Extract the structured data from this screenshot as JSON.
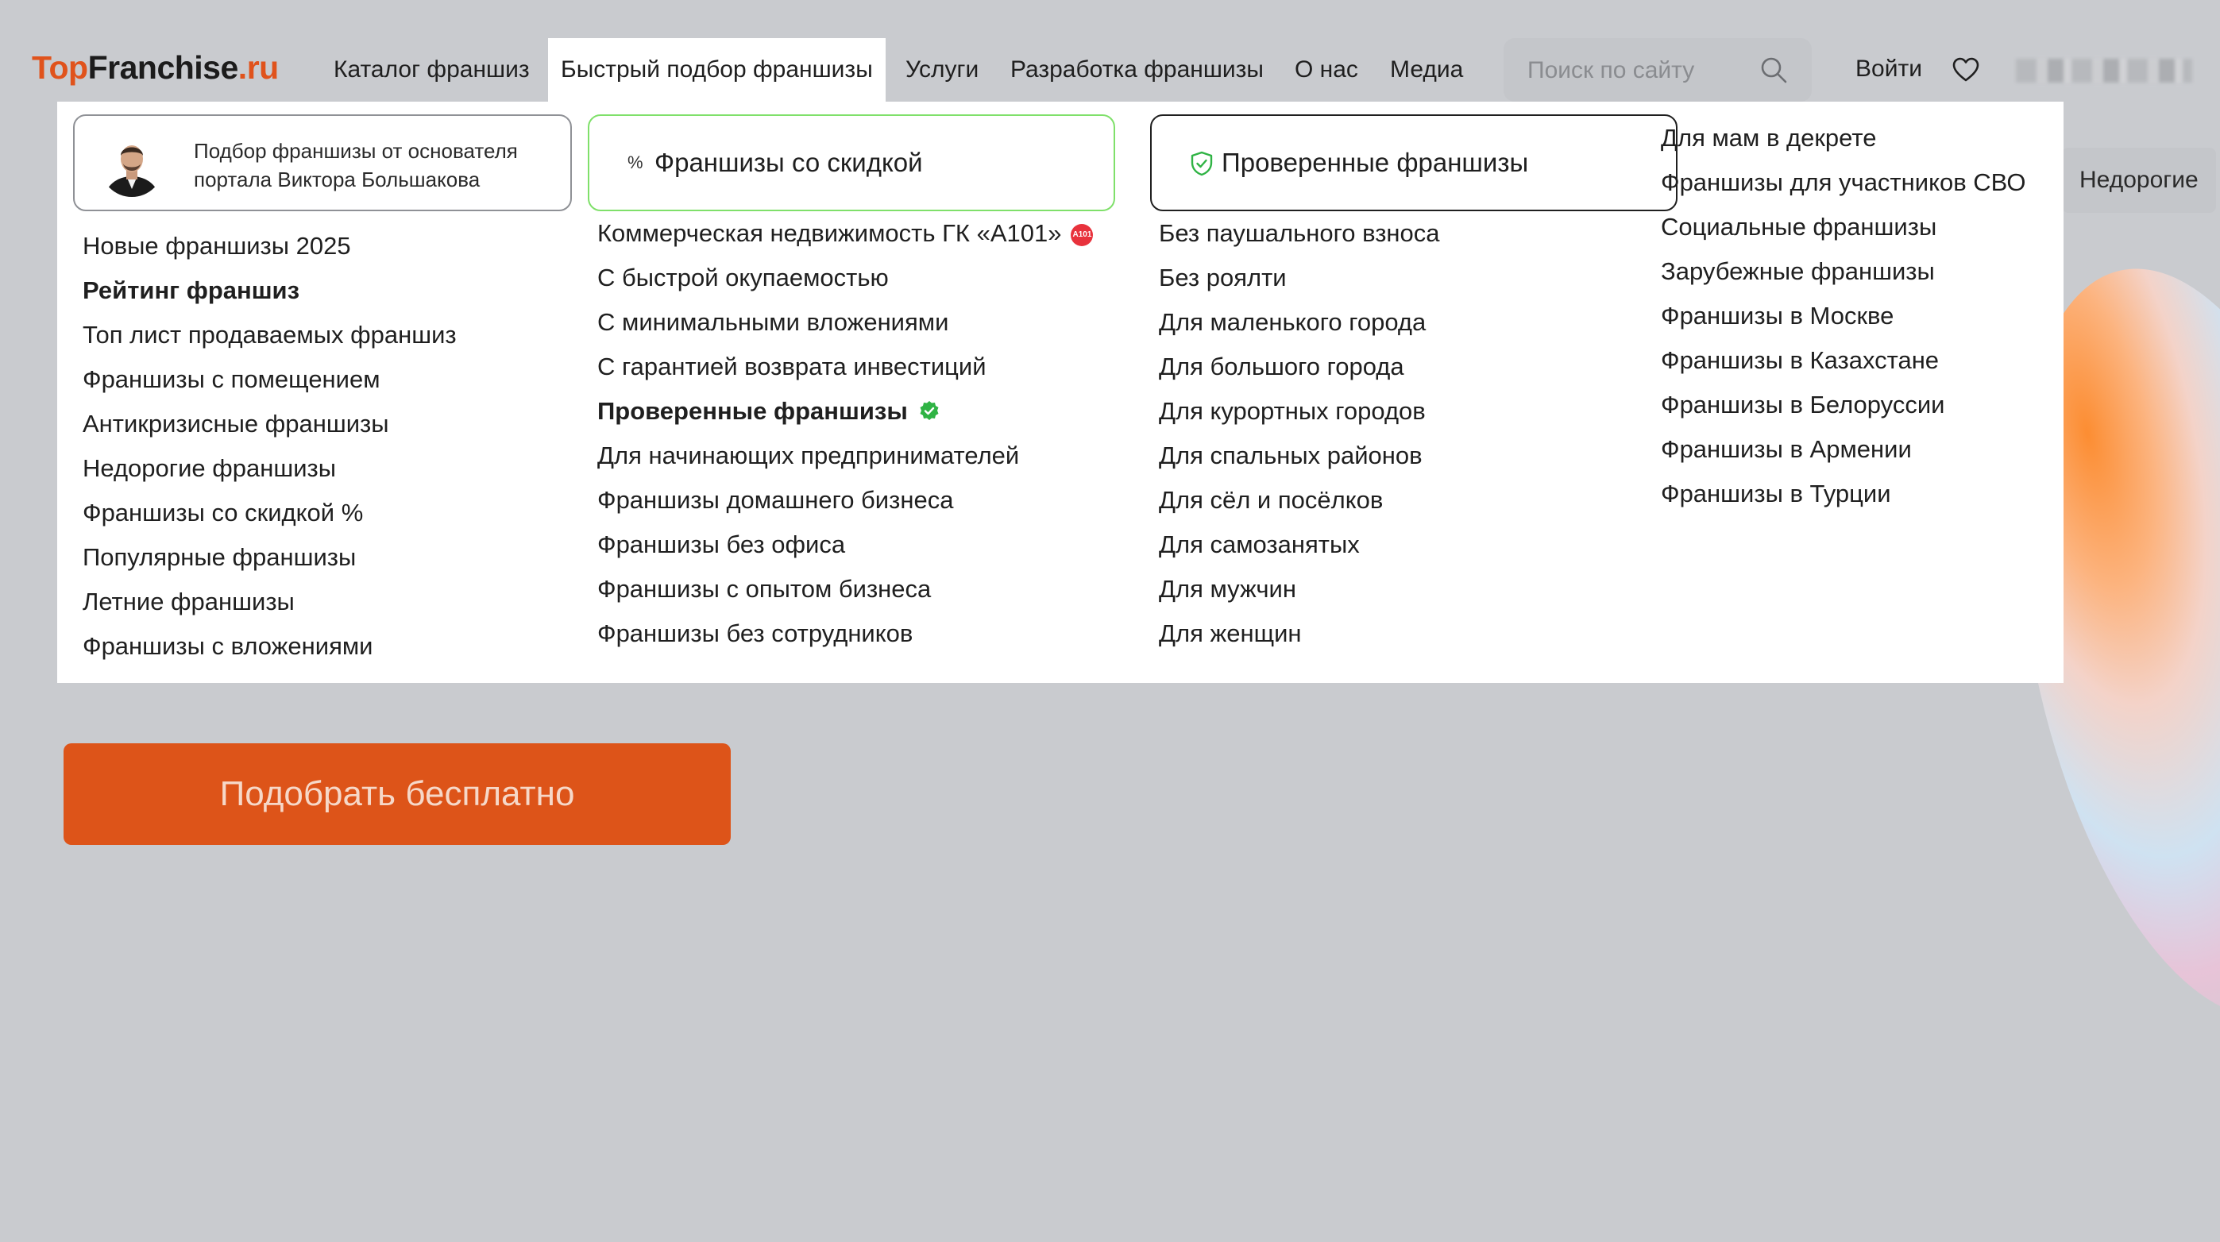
{
  "logo": {
    "part1": "Top",
    "part2": "Franchise",
    "part3": ".ru"
  },
  "nav": [
    {
      "label": "Каталог франшиз"
    },
    {
      "label": "Быстрый подбор франшизы"
    },
    {
      "label": "Услуги"
    },
    {
      "label": "Разработка франшизы"
    },
    {
      "label": "О нас"
    },
    {
      "label": "Медиа"
    }
  ],
  "search": {
    "placeholder": "Поиск по сайту"
  },
  "header": {
    "login": "Войти"
  },
  "background": {
    "tag": "Недорогие",
    "cta": "Подобрать бесплатно"
  },
  "dropdown": {
    "founder_card": "Подбор франшизы от основателя портала Виктора Большакова",
    "discount_card": {
      "icon": "%",
      "label": "Франшизы со скидкой"
    },
    "verified_card": {
      "label": "Проверенные франшизы"
    },
    "col1": [
      "Новые франшизы 2025",
      "Рейтинг франшиз",
      "Топ лист продаваемых франшиз",
      "Франшизы с помещением",
      "Антикризисные франшизы",
      "Недорогие франшизы",
      "Франшизы со скидкой %",
      "Популярные франшизы",
      "Летние франшизы",
      "Франшизы с вложениями"
    ],
    "col2": [
      "Коммерческая недвижимость ГК «А101»",
      "С быстрой окупаемостью",
      "С минимальными вложениями",
      "С гарантией возврата инвестиций",
      "Проверенные франшизы",
      "Для начинающих предпринимателей",
      "Франшизы домашнего бизнеса",
      "Франшизы без офиса",
      "Франшизы с опытом бизнеса",
      "Франшизы без сотрудников"
    ],
    "col2_badge": "A101",
    "col3": [
      "Без паушального взноса",
      "Без роялти",
      "Для маленького города",
      "Для большого города",
      "Для курортных городов",
      "Для спальных районов",
      "Для сёл и посёлков",
      "Для самозанятых",
      "Для мужчин",
      "Для женщин"
    ],
    "col4": [
      "Для мам в декрете",
      "Франшизы для участников СВО",
      "Социальные франшизы",
      "Зарубежные франшизы",
      "Франшизы в Москве",
      "Франшизы в Казахстане",
      "Франшизы в Белоруссии",
      "Франшизы в Армении",
      "Франшизы в Турции"
    ]
  },
  "colors": {
    "brand": "#e0531c",
    "cta": "#dd5419",
    "verified": "#2fb344",
    "a101": "#e8323c"
  }
}
